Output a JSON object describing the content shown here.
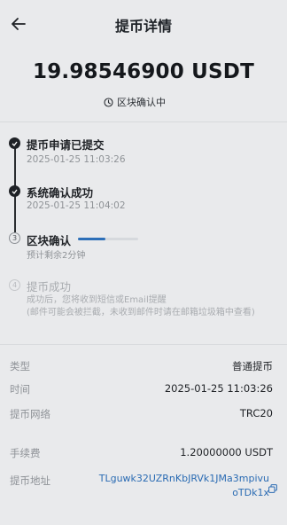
{
  "header": {
    "title": "提币详情"
  },
  "summary": {
    "amount": "19.98546900 USDT",
    "status": "区块确认中"
  },
  "steps": [
    {
      "title": "提币申请已提交",
      "time": "2025-01-25 11:03:26"
    },
    {
      "title": "系统确认成功",
      "time": "2025-01-25 11:04:02"
    },
    {
      "number": "3",
      "title": "区块确认",
      "subtitle": "预计剩余2分钟",
      "progress": 0.45
    },
    {
      "number": "4",
      "title": "提币成功",
      "note_line1": "成功后，您将收到短信或Email提醒",
      "note_line2": "(邮件可能会被拦截，未收到邮件时请在邮箱垃圾箱中查看)"
    }
  ],
  "details": {
    "type": {
      "label": "类型",
      "value": "普通提币"
    },
    "time": {
      "label": "时间",
      "value": "2025-01-25 11:03:26"
    },
    "network": {
      "label": "提币网络",
      "value": "TRC20"
    },
    "fee": {
      "label": "手续费",
      "value": "1.20000000 USDT"
    },
    "address": {
      "label": "提币地址",
      "value": "TLguwk32UZRnKbJRVk1JMa3mpivuoTDk1x"
    }
  }
}
